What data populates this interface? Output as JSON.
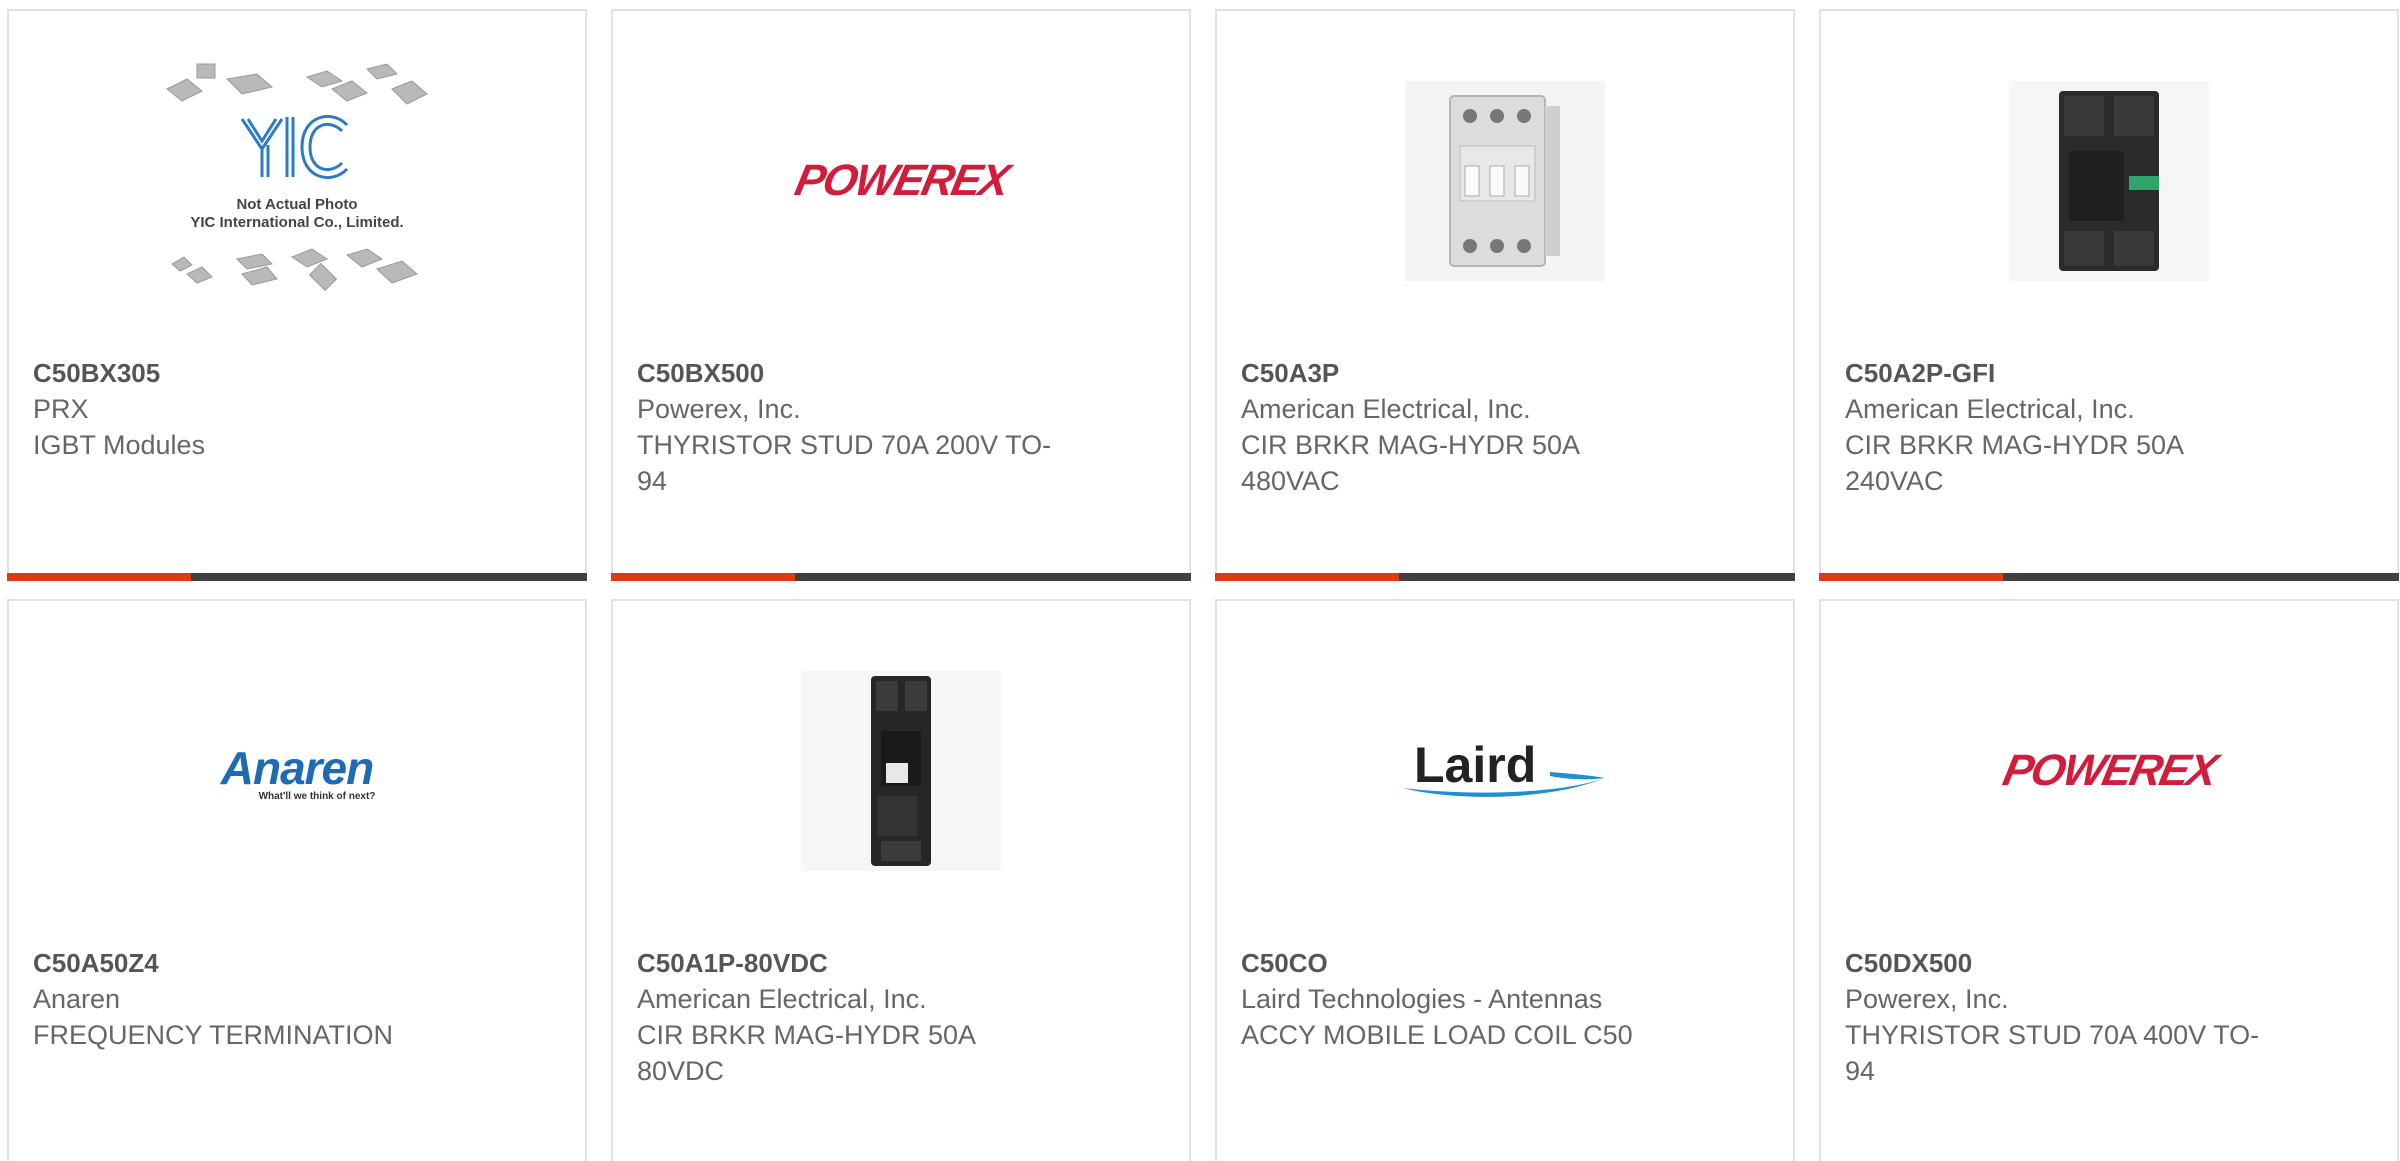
{
  "products": [
    {
      "part_number": "C50BX305",
      "manufacturer": "PRX",
      "description": "IGBT Modules",
      "image": "yic-placeholder-chips",
      "image_caption_line1": "Not Actual Photo",
      "image_caption_line2": "YIC International Co., Limited.",
      "image_logo_text": "YIC"
    },
    {
      "part_number": "C50BX500",
      "manufacturer": "Powerex, Inc.",
      "description": "THYRISTOR STUD 70A 200V TO-94",
      "image": "powerex-logo",
      "image_logo_text": "POWEREX"
    },
    {
      "part_number": "C50A3P",
      "manufacturer": "American Electrical, Inc.",
      "description": "CIR BRKR MAG-HYDR 50A 480VAC",
      "image": "circuit-breaker-3pole-white"
    },
    {
      "part_number": "C50A2P-GFI",
      "manufacturer": "American Electrical, Inc.",
      "description": "CIR BRKR MAG-HYDR 50A 240VAC",
      "image": "circuit-breaker-2pole-black"
    },
    {
      "part_number": "C50A50Z4",
      "manufacturer": "Anaren",
      "description": "FREQUENCY TERMINATION",
      "image": "anaren-logo",
      "image_logo_text": "Anaren",
      "image_logo_tagline": "What'll we think of next?"
    },
    {
      "part_number": "C50A1P-80VDC",
      "manufacturer": "American Electrical, Inc.",
      "description": "CIR BRKR MAG-HYDR 50A 80VDC",
      "image": "circuit-breaker-1pole-black"
    },
    {
      "part_number": "C50CO",
      "manufacturer": "Laird Technologies - Antennas",
      "description": "ACCY MOBILE LOAD COIL C50",
      "image": "laird-logo",
      "image_logo_text": "Laird"
    },
    {
      "part_number": "C50DX500",
      "manufacturer": "Powerex, Inc.",
      "description": "THYRISTOR STUD 70A 400V TO-94",
      "image": "powerex-logo",
      "image_logo_text": "POWEREX"
    }
  ],
  "colors": {
    "accent_bar": "#e03a14",
    "dark_bar": "#404040",
    "card_border": "#e2e2e2",
    "text_gray": "#666666",
    "powerex_red": "#d11c3b",
    "anaren_blue": "#1d6bb5",
    "laird_blue": "#1e8fd0"
  }
}
